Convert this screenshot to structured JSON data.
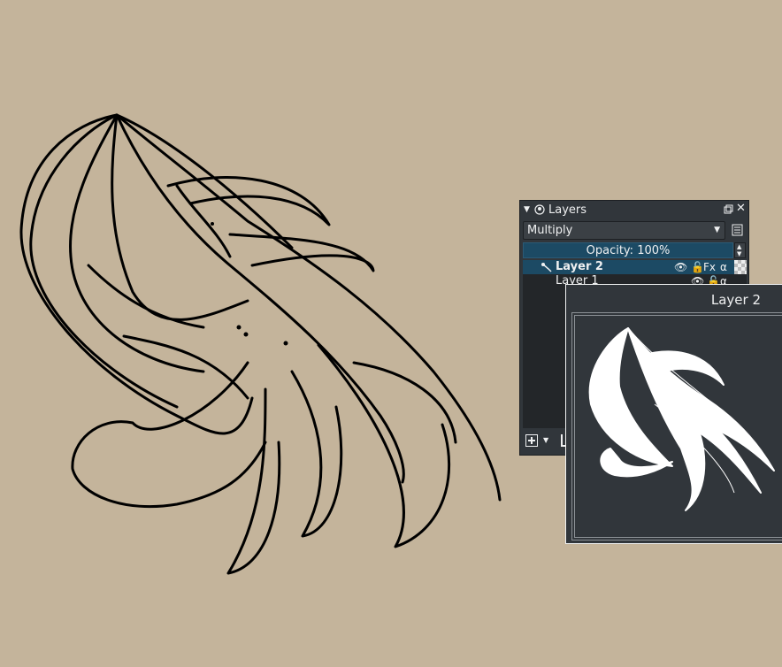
{
  "canvas": {
    "background": "#c4b49b",
    "stroke_color": "#000000"
  },
  "layers_docker": {
    "title": "Layers",
    "blend_mode": "Multiply",
    "opacity_text": "Opacity:  100%",
    "layers": [
      {
        "name": "Layer 2",
        "active": true
      },
      {
        "name": "Layer 1",
        "active": false
      }
    ]
  },
  "tooltip": {
    "title": "Layer 2",
    "preview_background": "#31363b"
  },
  "colors": {
    "panel": "#31363b",
    "selection": "#1c4a64",
    "text": "#eff0f1"
  },
  "icons": [
    "lock-icon",
    "visibility-icon",
    "fx-icon",
    "alpha-icon",
    "paintbrush-icon",
    "add-layer-icon"
  ]
}
